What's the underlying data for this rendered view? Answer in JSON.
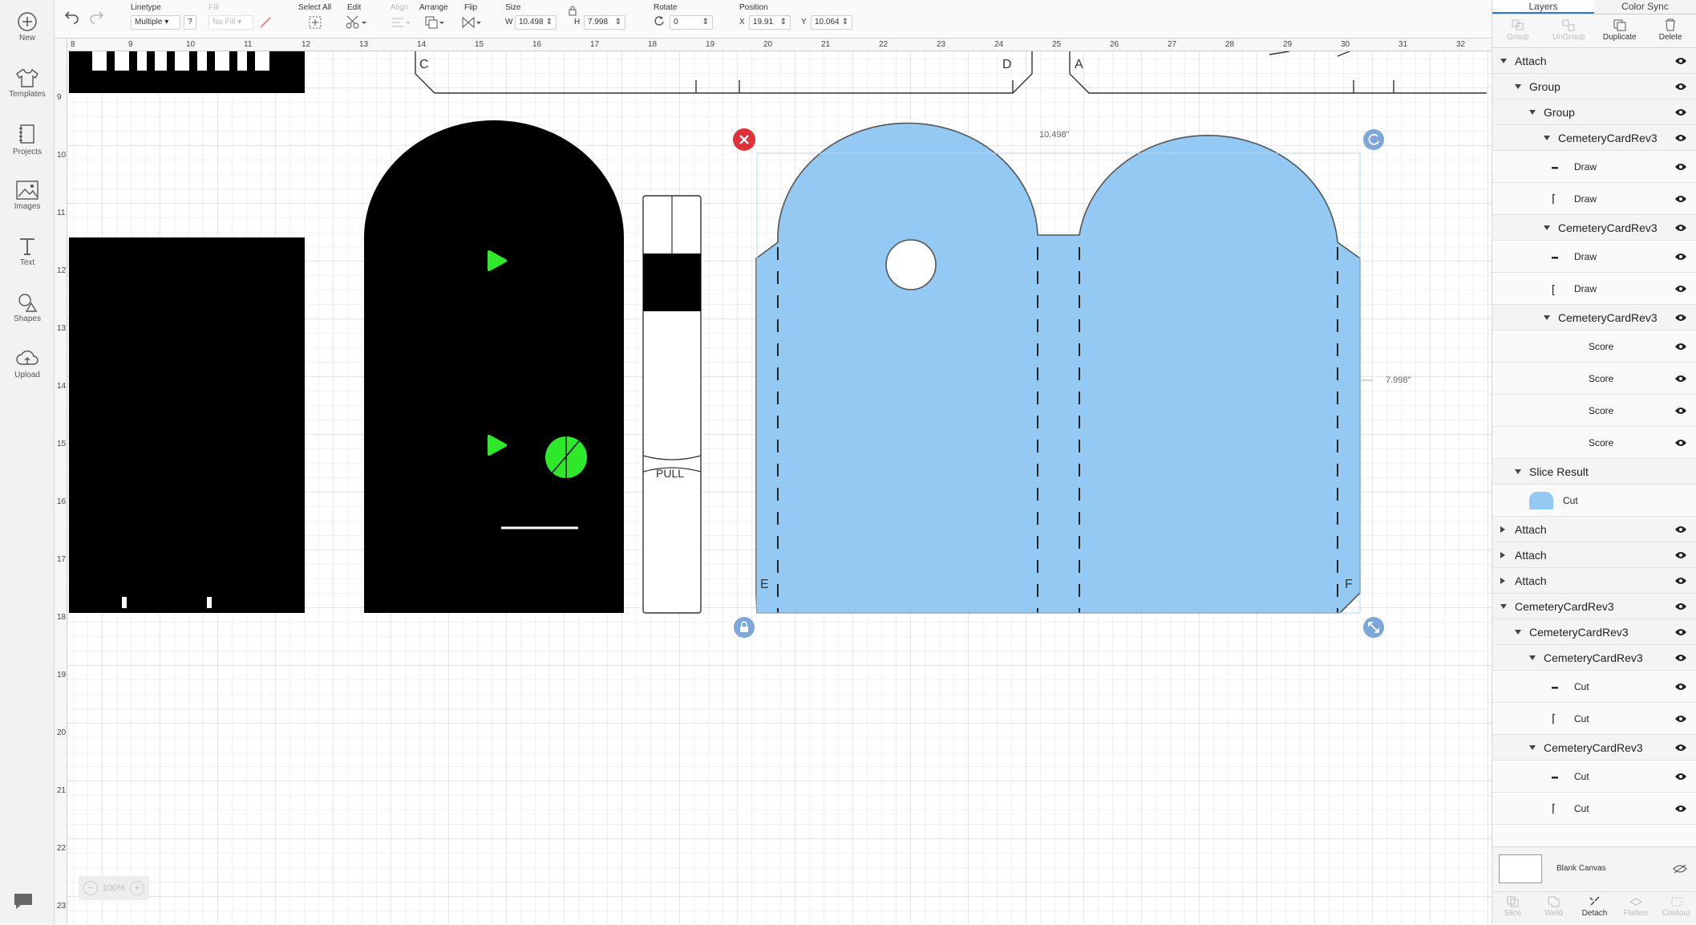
{
  "left_nav": [
    {
      "label": "New",
      "icon": "plus-circle-icon"
    },
    {
      "label": "Templates",
      "icon": "shirt-icon"
    },
    {
      "label": "Projects",
      "icon": "projects-icon"
    },
    {
      "label": "Images",
      "icon": "image-icon"
    },
    {
      "label": "Text",
      "icon": "text-icon"
    },
    {
      "label": "Shapes",
      "icon": "shapes-icon"
    },
    {
      "label": "Upload",
      "icon": "upload-icon"
    }
  ],
  "toolbar": {
    "linetype_label": "Linetype",
    "linetype_value": "Multiple",
    "linetype_help": "?",
    "fill_label": "Fill",
    "fill_value": "No Fill",
    "select_all_label": "Select All",
    "edit_label": "Edit",
    "align_label": "Align",
    "arrange_label": "Arrange",
    "flip_label": "Flip",
    "size_label": "Size",
    "w_label": "W",
    "w_value": "10.498",
    "h_label": "H",
    "h_value": "7.998",
    "rotate_label": "Rotate",
    "rotate_value": "0",
    "position_label": "Position",
    "x_label": "X",
    "x_value": "19.91",
    "y_label": "Y",
    "y_value": "10.064"
  },
  "canvas": {
    "ruler_top": [
      "8",
      "9",
      "10",
      "11",
      "12",
      "13",
      "14",
      "15",
      "16",
      "17",
      "18",
      "19",
      "20",
      "21",
      "22",
      "23",
      "24",
      "25",
      "26",
      "27",
      "28",
      "29",
      "30",
      "31",
      "32"
    ],
    "ruler_left": [
      "9",
      "10",
      "11",
      "12",
      "13",
      "14",
      "15",
      "16",
      "17",
      "18",
      "19",
      "20",
      "21",
      "22",
      "23"
    ],
    "width_dimension": "10.498\"",
    "height_dimension": "7.998\"",
    "pull_label": "PULL",
    "label_c": "C",
    "label_d": "D",
    "label_a": "A",
    "label_e": "E",
    "label_f": "F",
    "zoom_level": "100%",
    "accent_color": "#94c9f3",
    "handle_close_color": "#e0313b",
    "handle_blue_color": "#7da7d9"
  },
  "panel": {
    "tabs": [
      {
        "label": "Layers"
      },
      {
        "label": "Color Sync"
      }
    ],
    "actions": [
      {
        "label": "Group"
      },
      {
        "label": "UnGroup"
      },
      {
        "label": "Duplicate"
      },
      {
        "label": "Delete"
      }
    ],
    "layers": [
      {
        "label": "Attach"
      },
      {
        "label": "Group"
      },
      {
        "label": "Group"
      },
      {
        "label": "CemeteryCardRev3"
      },
      {
        "label": "Draw"
      },
      {
        "label": "Draw"
      },
      {
        "label": "CemeteryCardRev3"
      },
      {
        "label": "Draw"
      },
      {
        "label": "Draw"
      },
      {
        "label": "CemeteryCardRev3"
      },
      {
        "label": "Score"
      },
      {
        "label": "Score"
      },
      {
        "label": "Score"
      },
      {
        "label": "Score"
      },
      {
        "label": "Slice Result"
      },
      {
        "label": "Cut"
      },
      {
        "label": "Attach"
      },
      {
        "label": "Attach"
      },
      {
        "label": "Attach"
      },
      {
        "label": "CemeteryCardRev3"
      },
      {
        "label": "CemeteryCardRev3"
      },
      {
        "label": "CemeteryCardRev3"
      },
      {
        "label": "Cut"
      },
      {
        "label": "Cut"
      },
      {
        "label": "CemeteryCardRev3"
      },
      {
        "label": "Cut"
      },
      {
        "label": "Cut"
      }
    ],
    "blank_canvas_label": "Blank Canvas",
    "bottom_actions": [
      {
        "label": "Slice"
      },
      {
        "label": "Weld"
      },
      {
        "label": "Detach"
      },
      {
        "label": "Flatten"
      },
      {
        "label": "Contour"
      }
    ]
  }
}
